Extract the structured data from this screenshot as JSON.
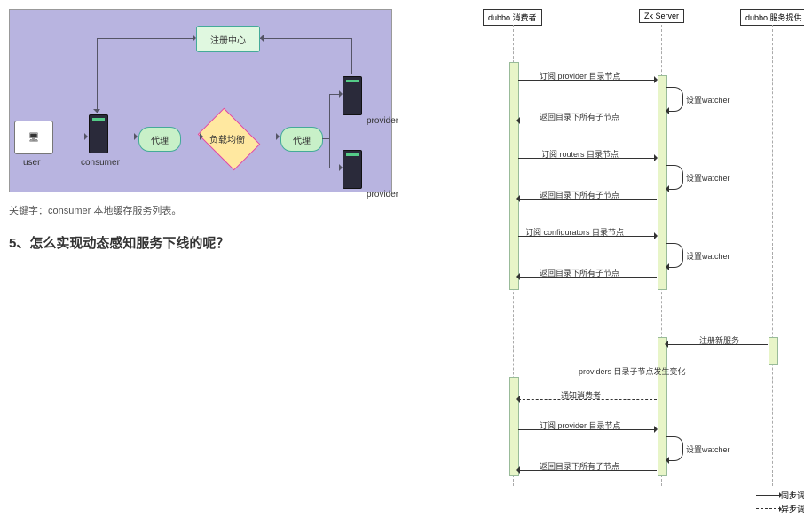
{
  "arch": {
    "registry": "注册中心",
    "proxy": "代理",
    "load_balance": "负载均衡",
    "labels": {
      "user": "user",
      "consumer": "consumer",
      "provider": "provider"
    }
  },
  "left": {
    "caption": "关键字：consumer 本地缓存服务列表。",
    "heading": "5、怎么实现动态感知服务下线的呢？"
  },
  "seq": {
    "participants": {
      "consumer": "dubbo 消费者",
      "zk": "Zk Server",
      "provider": "dubbo 服务提供"
    },
    "msgs": {
      "sub_provider": "订阅 provider 目录节点",
      "ret_children": "返回目录下所有子节点",
      "sub_routers": "订阅 routers 目录节点",
      "sub_configs": "订阅 configurators 目录节点",
      "set_watcher": "设置watcher",
      "register_new": "注册新服务",
      "providers_change": "providers 目录子节点发生变化",
      "notify_consumer": "通知消费者"
    },
    "legend": {
      "sync": "同步调用",
      "async": "异步调用"
    }
  },
  "chart_data": [
    {
      "type": "diagram-flow",
      "title": "consumer 本地缓存服务列表",
      "nodes": [
        {
          "id": "user",
          "label": "user",
          "kind": "client"
        },
        {
          "id": "consumer",
          "label": "consumer",
          "kind": "server"
        },
        {
          "id": "proxy1",
          "label": "代理",
          "kind": "proxy"
        },
        {
          "id": "lb",
          "label": "负载均衡",
          "kind": "load-balance"
        },
        {
          "id": "proxy2",
          "label": "代理",
          "kind": "proxy"
        },
        {
          "id": "registry",
          "label": "注册中心",
          "kind": "registry"
        },
        {
          "id": "provider1",
          "label": "provider",
          "kind": "server"
        },
        {
          "id": "provider2",
          "label": "provider",
          "kind": "server"
        }
      ],
      "edges": [
        {
          "from": "user",
          "to": "consumer"
        },
        {
          "from": "consumer",
          "to": "proxy1"
        },
        {
          "from": "proxy1",
          "to": "lb"
        },
        {
          "from": "lb",
          "to": "proxy2"
        },
        {
          "from": "proxy2",
          "to": "provider1"
        },
        {
          "from": "proxy2",
          "to": "provider2"
        },
        {
          "from": "consumer",
          "to": "registry",
          "bidir": true
        },
        {
          "from": "provider1",
          "to": "registry"
        },
        {
          "from": "provider2",
          "to": "registry"
        }
      ]
    },
    {
      "type": "diagram-sequence",
      "participants": [
        "dubbo 消费者",
        "Zk Server",
        "dubbo 服务提供"
      ],
      "messages": [
        {
          "from": "dubbo 消费者",
          "to": "Zk Server",
          "text": "订阅 provider 目录节点",
          "sync": true
        },
        {
          "from": "Zk Server",
          "to": "Zk Server",
          "text": "设置watcher",
          "self": true
        },
        {
          "from": "Zk Server",
          "to": "dubbo 消费者",
          "text": "返回目录下所有子节点",
          "sync": true
        },
        {
          "from": "dubbo 消费者",
          "to": "Zk Server",
          "text": "订阅 routers 目录节点",
          "sync": true
        },
        {
          "from": "Zk Server",
          "to": "Zk Server",
          "text": "设置watcher",
          "self": true
        },
        {
          "from": "Zk Server",
          "to": "dubbo 消费者",
          "text": "返回目录下所有子节点",
          "sync": true
        },
        {
          "from": "dubbo 消费者",
          "to": "Zk Server",
          "text": "订阅 configurators 目录节点",
          "sync": true
        },
        {
          "from": "Zk Server",
          "to": "Zk Server",
          "text": "设置watcher",
          "self": true
        },
        {
          "from": "Zk Server",
          "to": "dubbo 消费者",
          "text": "返回目录下所有子节点",
          "sync": true
        },
        {
          "from": "dubbo 服务提供",
          "to": "Zk Server",
          "text": "注册新服务",
          "sync": true
        },
        {
          "from": "Zk Server",
          "to": "Zk Server",
          "text": "providers 目录子节点发生变化",
          "self": true
        },
        {
          "from": "Zk Server",
          "to": "dubbo 消费者",
          "text": "通知消费者",
          "sync": false
        },
        {
          "from": "dubbo 消费者",
          "to": "Zk Server",
          "text": "订阅 provider 目录节点",
          "sync": true
        },
        {
          "from": "Zk Server",
          "to": "Zk Server",
          "text": "设置watcher",
          "self": true
        },
        {
          "from": "Zk Server",
          "to": "dubbo 消费者",
          "text": "返回目录下所有子节点",
          "sync": true
        }
      ],
      "legend": {
        "sync": "同步调用",
        "async": "异步调用"
      }
    }
  ]
}
